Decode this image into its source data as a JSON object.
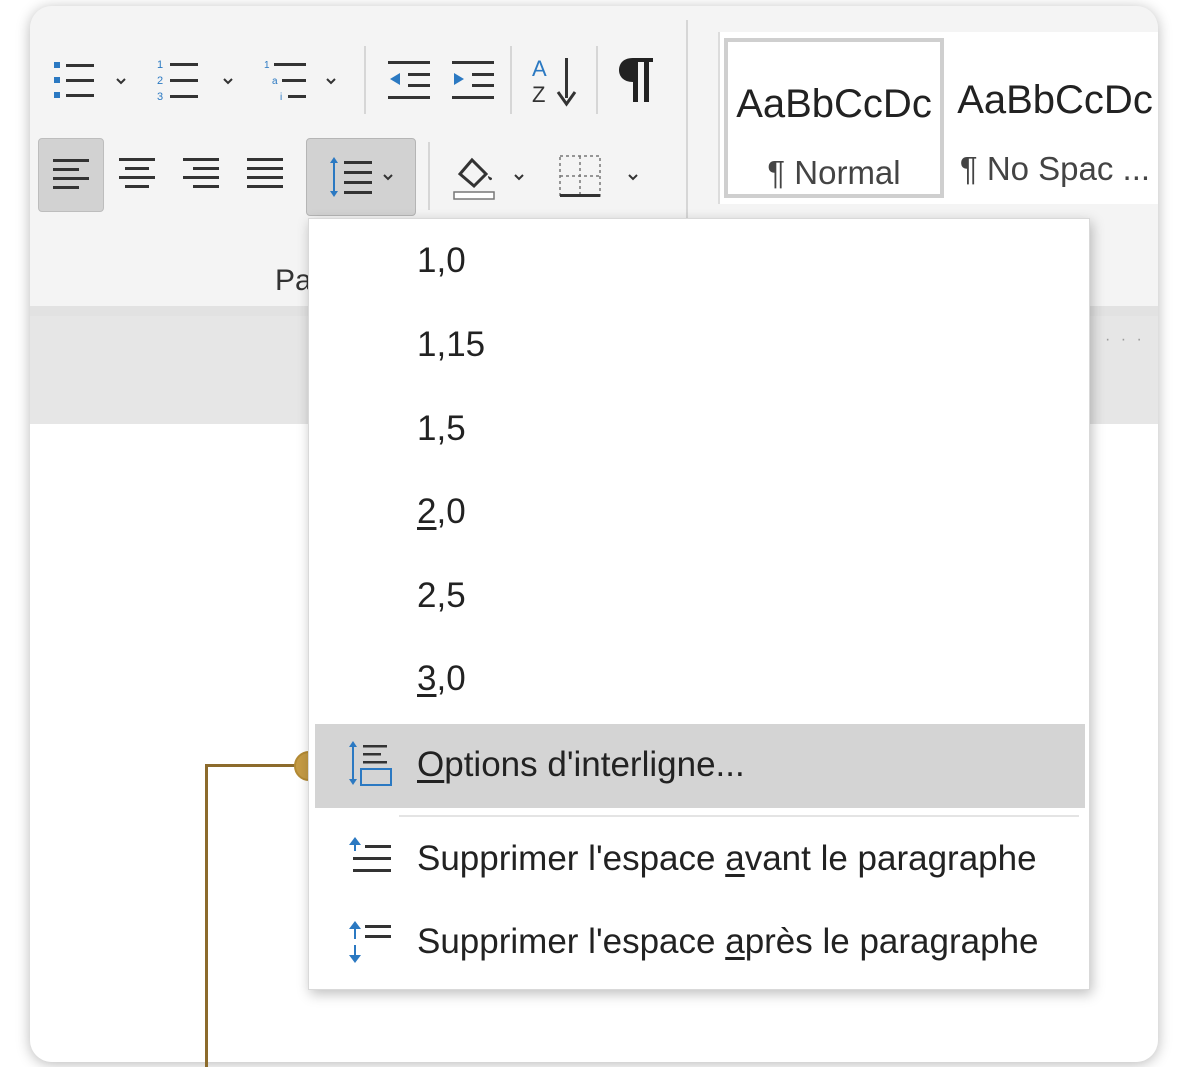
{
  "ribbon": {
    "group_label": "Pa",
    "row1_icons": [
      "bullets-icon",
      "numbering-icon",
      "multilevel-list-icon",
      "decrease-indent-icon",
      "increase-indent-icon",
      "sort-icon",
      "pilcrow-icon"
    ],
    "row2_icons": [
      "align-left-icon",
      "align-center-icon",
      "align-right-icon",
      "justify-icon",
      "line-spacing-icon",
      "shading-icon",
      "borders-icon"
    ],
    "accent_color": "#2b79c2"
  },
  "styles": [
    {
      "sample": "AaBbCcDc",
      "name": "¶ Normal"
    },
    {
      "sample": "AaBbCcDc",
      "name": "¶ No Spac ..."
    }
  ],
  "menu": {
    "spacing_options": [
      {
        "pre": "",
        "u": "",
        "post": "1,0"
      },
      {
        "pre": "",
        "u": "",
        "post": "1,15"
      },
      {
        "pre": "",
        "u": "",
        "post": "1,5"
      },
      {
        "pre": "",
        "u": "2",
        "post": ",0"
      },
      {
        "pre": "",
        "u": "",
        "post": "2,5"
      },
      {
        "pre": "",
        "u": "3",
        "post": ",0"
      }
    ],
    "options_item": {
      "u": "O",
      "rest": "ptions d'interligne...",
      "icon": "line-spacing-options-icon"
    },
    "remove_before": {
      "pre": "Supprimer l'espace ",
      "u": "a",
      "post": "vant le paragraphe",
      "icon": "remove-space-before-icon"
    },
    "remove_after": {
      "pre": "Supprimer l'espace ",
      "u": "a",
      "post": "près le paragraphe",
      "icon": "remove-space-after-icon"
    }
  },
  "callout_color": "#c59b45"
}
